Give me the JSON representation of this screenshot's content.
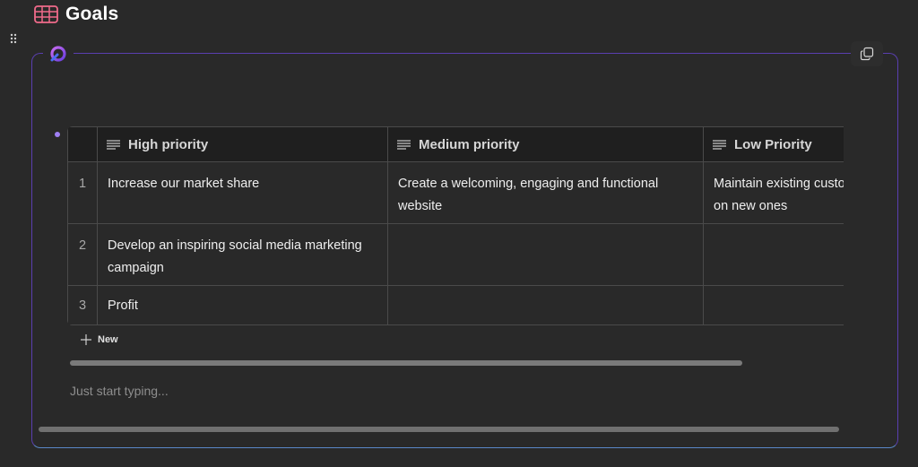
{
  "page": {
    "title": "Goals",
    "title_icon": "table-grid-icon"
  },
  "table": {
    "columns": [
      {
        "icon": "text-lines-icon",
        "label": "High priority"
      },
      {
        "icon": "text-lines-icon",
        "label": "Medium priority"
      },
      {
        "icon": "text-lines-icon",
        "label": "Low Priority"
      }
    ],
    "rows": [
      {
        "num": "1",
        "cells": [
          "Increase our market share",
          "Create a welcoming, engaging and functional website",
          "Maintain existing custo"
        ],
        "low_line2": "on new ones"
      },
      {
        "num": "2",
        "cells": [
          "Develop an inspiring social media marketing campaign",
          "",
          ""
        ]
      },
      {
        "num": "3",
        "cells": [
          "Profit",
          "",
          ""
        ]
      }
    ],
    "new_label": "New"
  },
  "editor": {
    "placeholder": "Just start typing..."
  },
  "colors": {
    "background": "#292929",
    "card_border": "#5a3fb0",
    "bullet": "#9f7ff3"
  }
}
